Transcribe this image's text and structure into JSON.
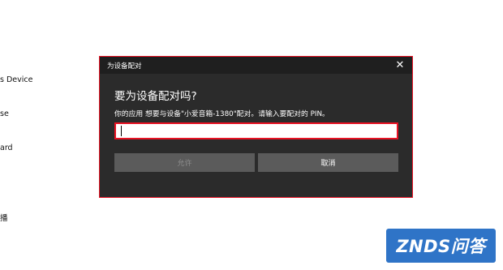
{
  "background": {
    "items": [
      "s Device",
      "se",
      "ard",
      "播"
    ]
  },
  "dialog": {
    "title": "为设备配对",
    "close_glyph": "✕",
    "heading": "要为设备配对吗?",
    "description": "你的应用 想要与设备\"小爱音箱-1380\"配对。请输入要配对的 PIN。",
    "pin": {
      "value": "",
      "placeholder": ""
    },
    "buttons": {
      "allow": "允许",
      "cancel": "取消"
    }
  },
  "colors": {
    "accent_border": "#e81123",
    "dialog_bg": "#2b2b2b",
    "title_bar_bg": "#1f1f1f",
    "button_bg": "#5b5b5b",
    "watermark_bg": "#2f74c7"
  },
  "watermark": {
    "text": "ZNDS问答"
  }
}
